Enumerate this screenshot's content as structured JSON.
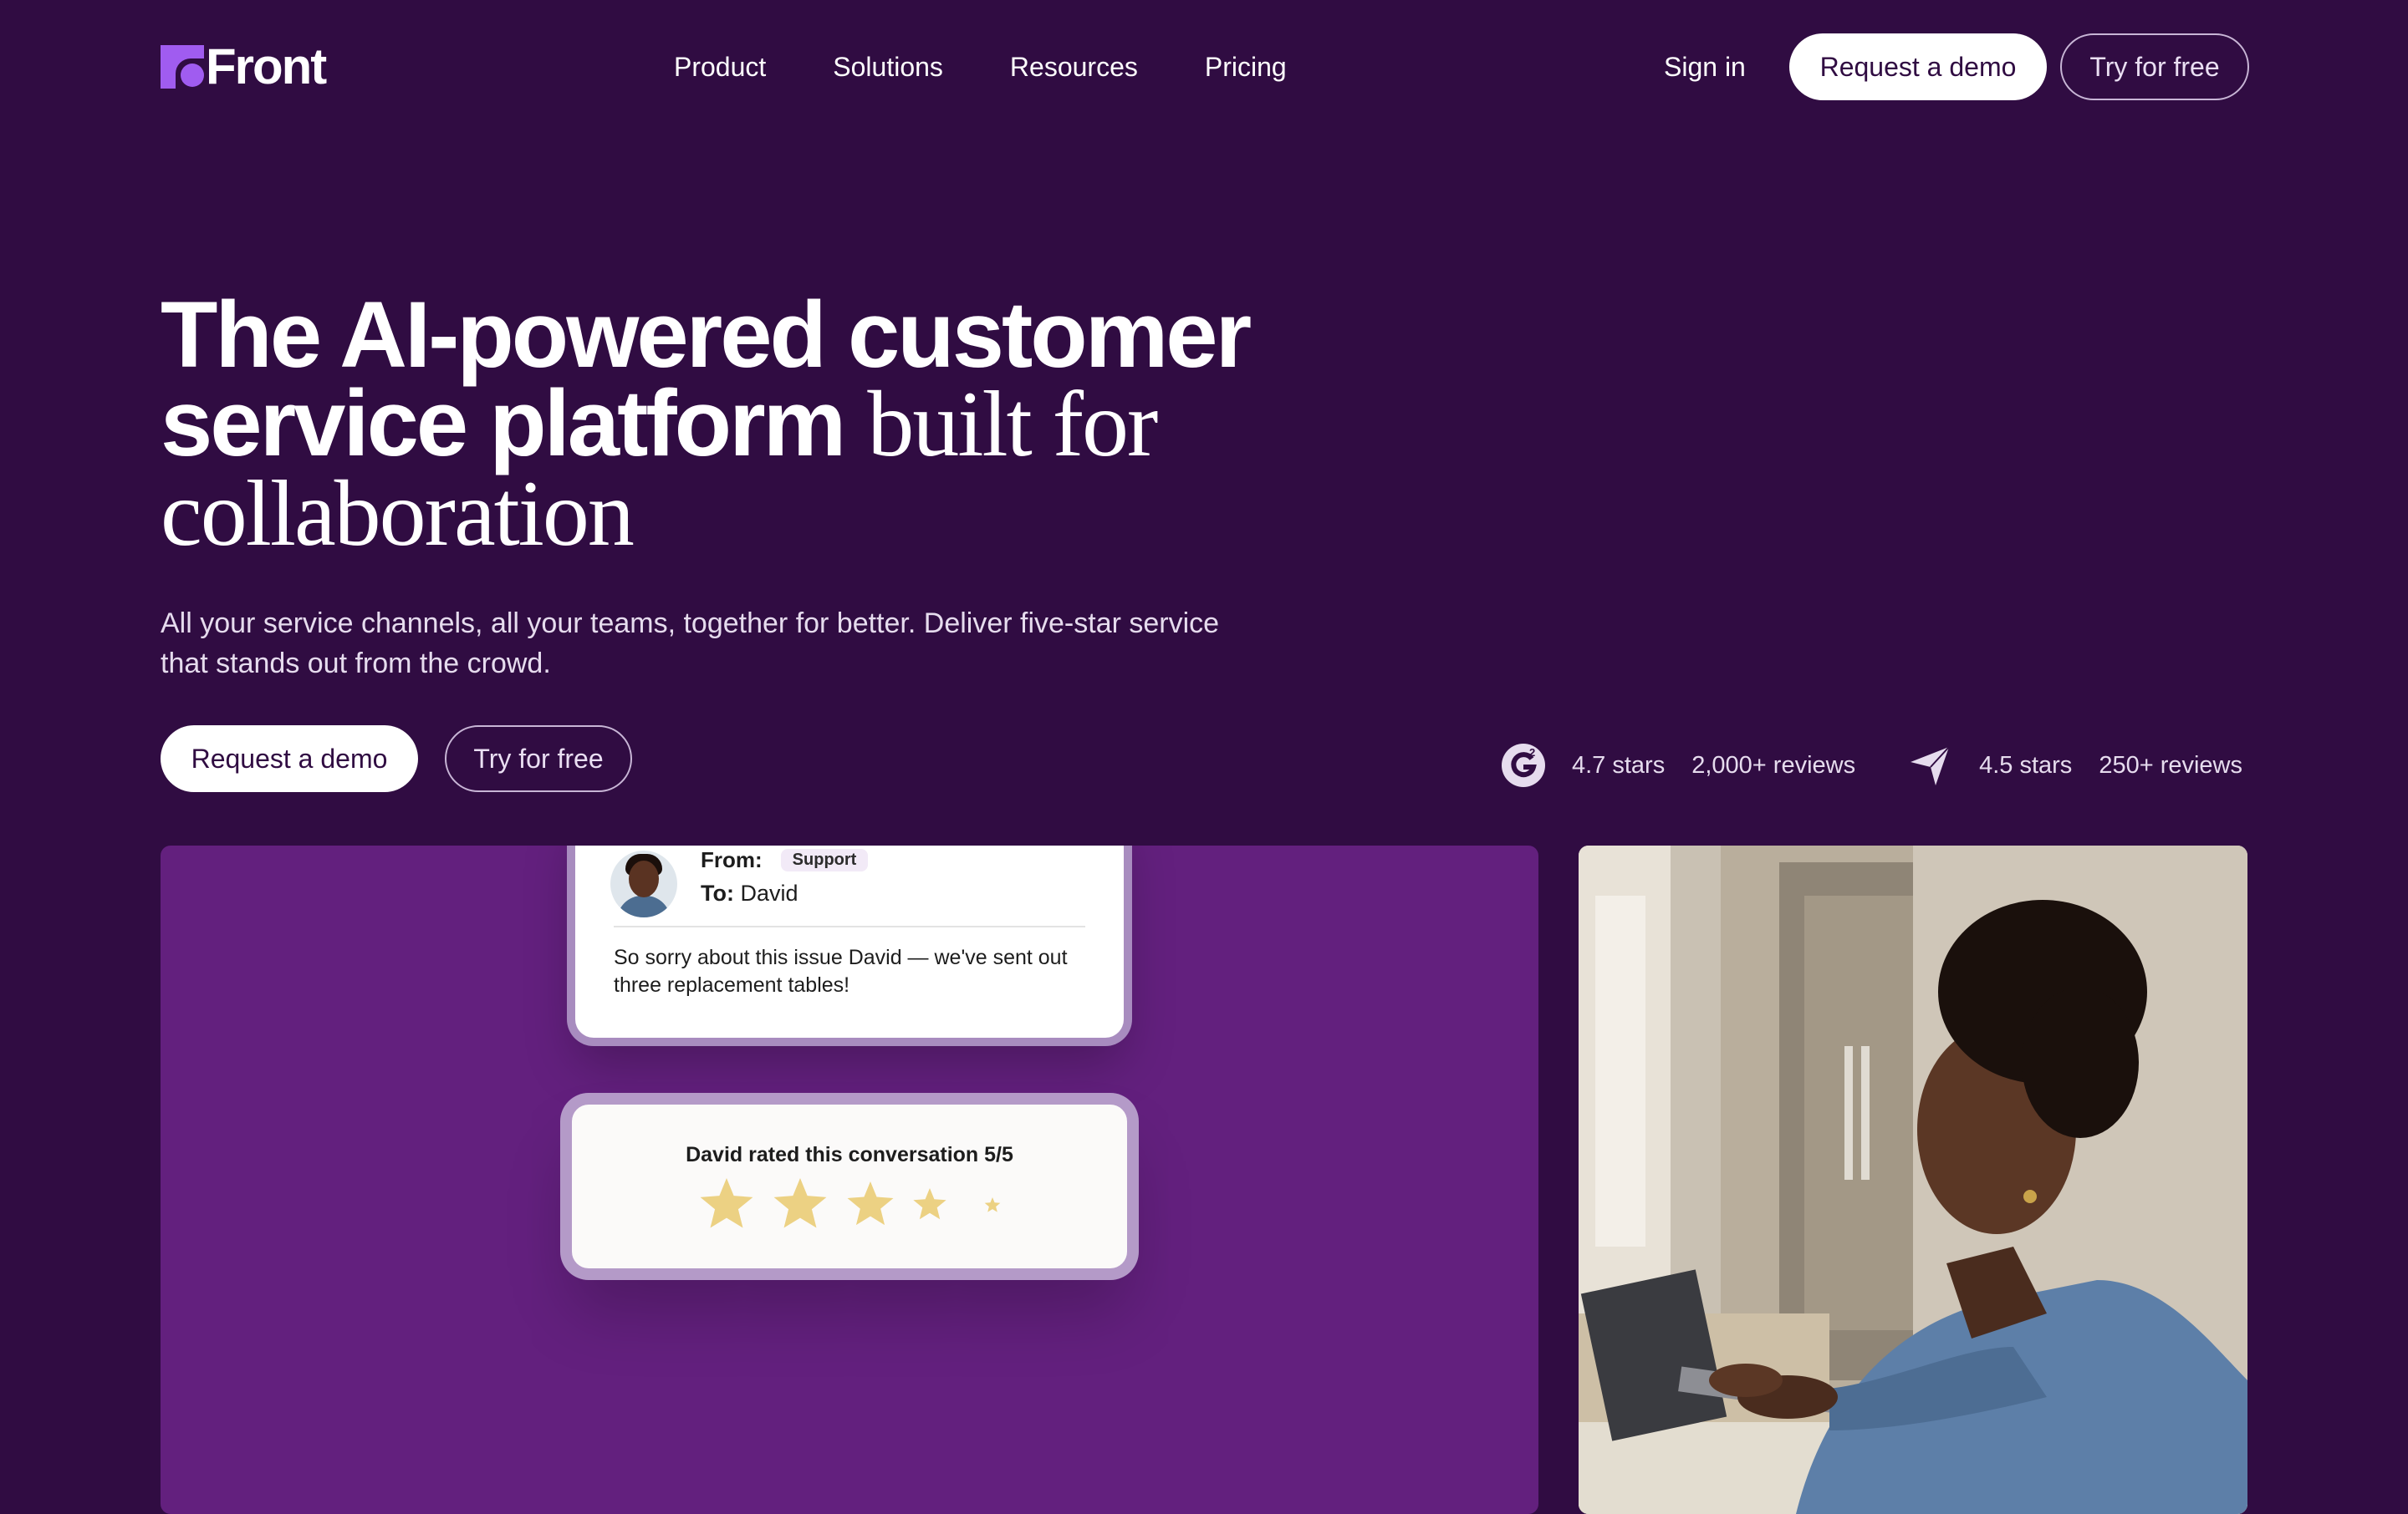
{
  "brand": {
    "name": "Front",
    "accent": "#a05cf0",
    "background": "#300c42",
    "panel": "#63207e"
  },
  "nav": {
    "items": [
      {
        "label": "Product"
      },
      {
        "label": "Solutions"
      },
      {
        "label": "Resources"
      },
      {
        "label": "Pricing"
      }
    ],
    "sign_in": "Sign in",
    "request_demo": "Request a demo",
    "try_free": "Try for free"
  },
  "hero": {
    "headline_sans": "The AI-powered customer service platform",
    "headline_serif": "built for collaboration",
    "subtitle": "All your service channels, all your teams, together for better. Deliver five-star service that stands out from the crowd.",
    "request_demo": "Request a demo",
    "try_free": "Try for free"
  },
  "ratings": [
    {
      "icon": "g2-icon",
      "stars": "4.7 stars",
      "reviews": "2,000+ reviews"
    },
    {
      "icon": "capterra-icon",
      "stars": "4.5 stars",
      "reviews": "250+ reviews"
    }
  ],
  "email_card": {
    "from_label": "From:",
    "from_tag": "Support",
    "to_label": "To:",
    "to_name": "David",
    "message": "So sorry about this issue David — we've sent out three replacement tables!"
  },
  "rating_card": {
    "title": "David rated this conversation 5/5",
    "rating": 5,
    "max": 5,
    "star_color": "#ecd183"
  }
}
